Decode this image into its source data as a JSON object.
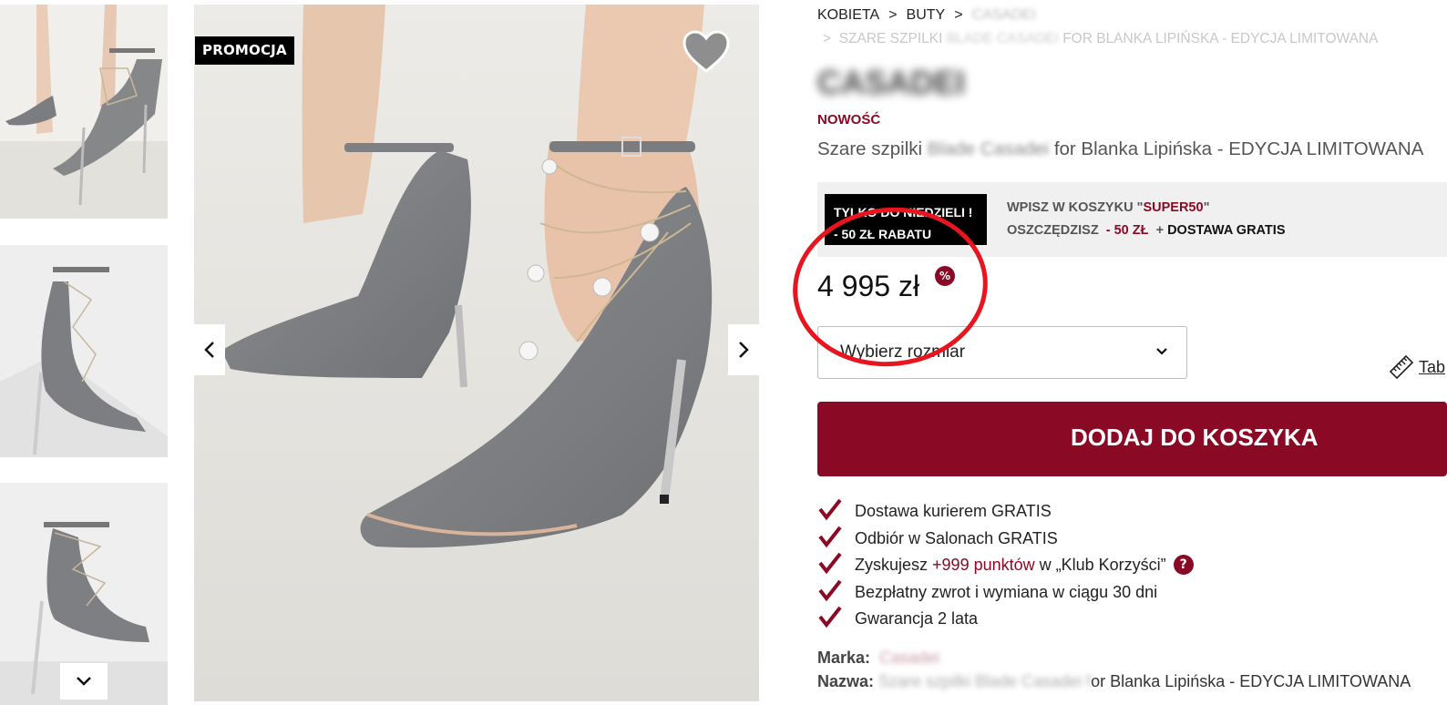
{
  "breadcrumb": {
    "items": [
      "KOBIETA",
      "BUTY",
      "CASADEI"
    ],
    "separator": ">",
    "current": "SZARE SZPILKI BLADE CASADEI FOR BLANKA LIPIŃSKA - EDYCJA LIMITOWANA",
    "current_prefix": "SZARE SZPILKI",
    "current_blurred": "BLADE CASADEI",
    "current_suffix": "FOR BLANKA LIPIŃSKA - EDYCJA LIMITOWANA"
  },
  "product": {
    "brand": "CASADEI",
    "new_label": "NOWOŚĆ",
    "name_prefix": "Szare szpilki",
    "name_blurred": "Blade Casadei",
    "name_suffix": "for Blanka Lipińska - EDYCJA LIMITOWANA",
    "price": "4 995 zł",
    "price_badge": "%"
  },
  "gallery": {
    "promo_badge": "PROMOCJA",
    "thumbnails": [
      "thumb-front-view",
      "thumb-side-view",
      "thumb-profile-view"
    ],
    "icons": {
      "favorite": "heart-icon",
      "prev": "chevron-left-icon",
      "next": "chevron-right-icon",
      "thumbs_down": "chevron-down-icon"
    }
  },
  "promo": {
    "badge_line1": "TYLKO DO NIEDZIELI !",
    "badge_line2": "- 50 ZŁ RABATU",
    "line1_prefix": "WPISZ W KOSZYKU \"",
    "code": "SUPER50",
    "line1_suffix": "\"",
    "line2_prefix": "OSZCZĘDZISZ",
    "discount": "- 50 ZŁ",
    "line2_plus": "+",
    "line2_suffix": "DOSTAWA GRATIS"
  },
  "size": {
    "placeholder": "Wybierz rozmiar",
    "table_label": "Tab"
  },
  "cart": {
    "add_label": "DODAJ DO KOSZYKA"
  },
  "benefits": [
    {
      "text": "Dostawa kurierem GRATIS"
    },
    {
      "text": "Odbiór w Salonach GRATIS"
    },
    {
      "prefix": "Zyskujesz ",
      "highlight": "+999 punktów",
      "mid": " w ",
      "suffix": "„Klub Korzyści”",
      "help": "?"
    },
    {
      "text": "Bezpłatny zwrot i wymiana w ciągu 30 dni"
    },
    {
      "text": "Gwarancja 2 lata"
    }
  ],
  "meta": {
    "brand_label": "Marka:",
    "brand_value": "Casadei",
    "name_label": "Nazwa:",
    "name_value_blurred": "Szare szpilki Blade Casadei f",
    "name_value_visible": "or Blanka Lipińska - EDYCJA LIMITOWANA"
  },
  "colors": {
    "brand_red": "#8a0a25",
    "annotation_red": "#e8141e",
    "promo_bg": "#f0f0f0"
  }
}
